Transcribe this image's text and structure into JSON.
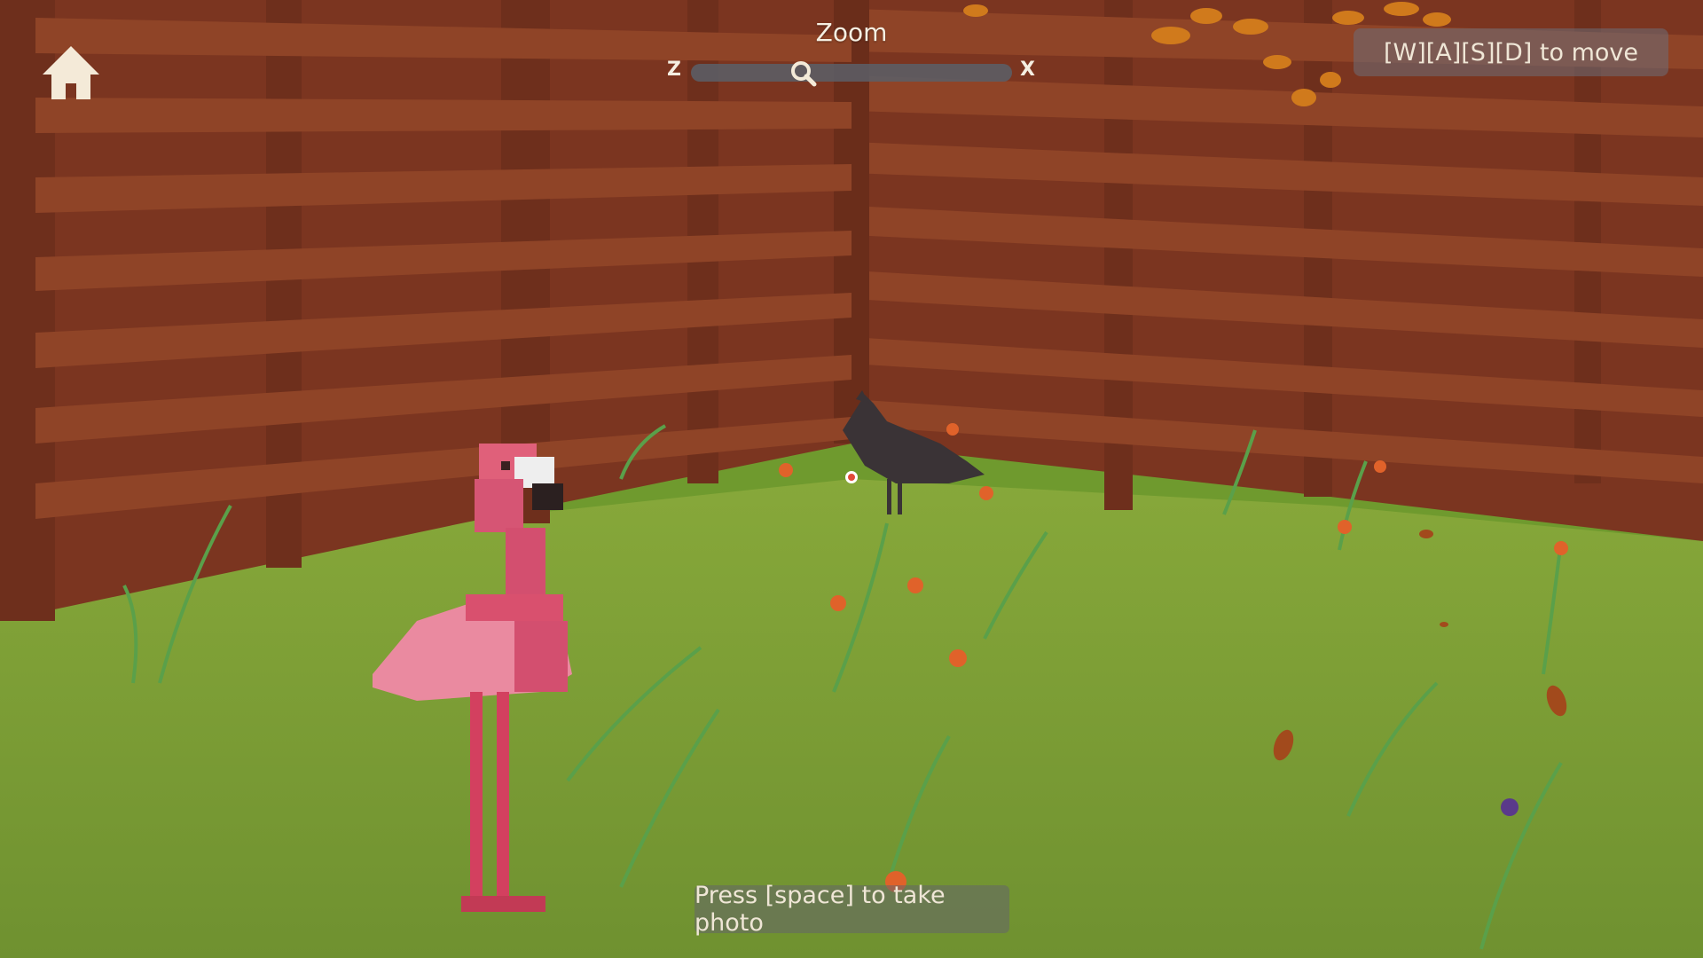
{
  "hud": {
    "zoom_title": "Zoom",
    "zoom_out_key": "Z",
    "zoom_in_key": "X",
    "zoom_level": 0.35,
    "move_hint": "[W][A][S][D] to move",
    "photo_hint": "Press [space] to take photo"
  },
  "icons": {
    "home": "home-icon",
    "zoom_handle": "magnifier-icon",
    "reticle": "camera-reticle"
  },
  "colors": {
    "fence": "#8a3f24",
    "grass": "#7ea334",
    "flamingo": "#e8607a",
    "hud_text": "#f3ead8"
  }
}
